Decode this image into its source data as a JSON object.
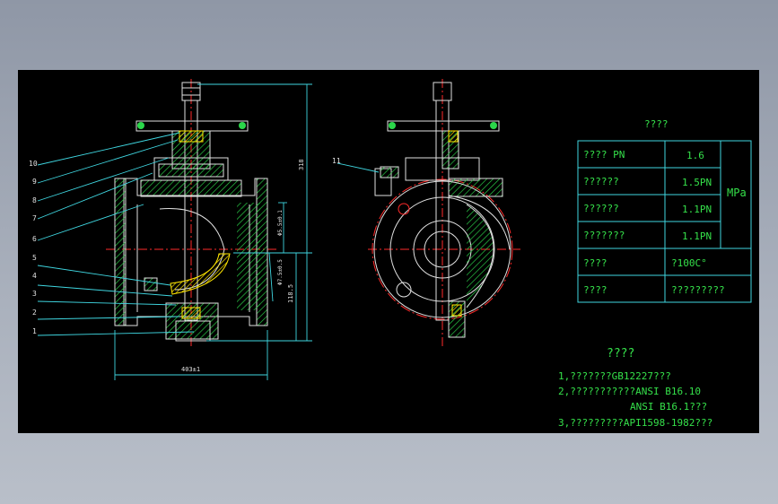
{
  "table": {
    "title": "????",
    "rows": [
      {
        "label": "????  PN",
        "value": "1.6"
      },
      {
        "label": "??????",
        "value": "1.5PN"
      },
      {
        "label": "??????",
        "value": "1.1PN"
      },
      {
        "label": "???????",
        "value": "1.1PN"
      },
      {
        "label": "????",
        "value": "?100C°"
      },
      {
        "label": "????",
        "value": "?????????"
      }
    ],
    "unit": "MPa"
  },
  "notes": {
    "title": "????",
    "lines": [
      "1,???????GB12227???",
      "2,???????????ANSI B16.10",
      "ANSI B16.1???",
      "3,?????????API1598-1982???"
    ]
  },
  "part_labels": [
    "10",
    "9",
    "8",
    "7",
    "6",
    "5",
    "4",
    "3",
    "2",
    "1"
  ],
  "section_label": "11",
  "dimensions": {
    "total_height": "318",
    "lower_height": "118.5",
    "flange_width": "403±1",
    "flange_dia_1": "Φ5.5±0.1",
    "flange_dia_2": "Φ7.5±0.5"
  },
  "colors": {
    "background": "#000000",
    "line_white": "#e0e0e0",
    "hatch_green": "#2bd64a",
    "text_green": "#35e04a",
    "leader_cyan": "#3fd6e0",
    "seal_yellow": "#ffe600",
    "center_red": "#ff2a2a",
    "frame_gray": "#9aa1ad"
  }
}
